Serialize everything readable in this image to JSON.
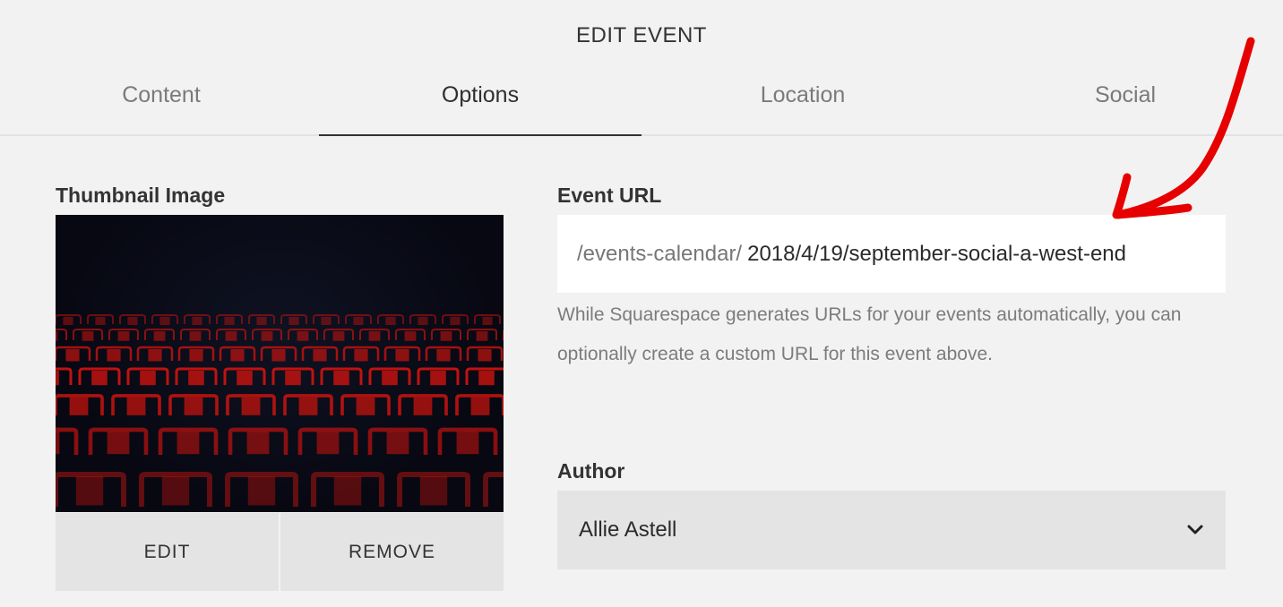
{
  "dialog": {
    "title": "EDIT EVENT"
  },
  "tabs": [
    {
      "label": "Content",
      "active": false
    },
    {
      "label": "Options",
      "active": true
    },
    {
      "label": "Location",
      "active": false
    },
    {
      "label": "Social",
      "active": false
    }
  ],
  "thumbnail": {
    "label": "Thumbnail Image",
    "edit_label": "EDIT",
    "remove_label": "REMOVE"
  },
  "event_url": {
    "label": "Event URL",
    "prefix": "/events-calendar/",
    "value": "2018/4/19/september-social-a-west-end",
    "help": "While Squarespace generates URLs for your events automatically, you can optionally create a custom URL for this event above."
  },
  "author": {
    "label": "Author",
    "selected": "Allie Astell"
  },
  "colors": {
    "background": "#f2f2f2",
    "annotation": "#e60000",
    "seats": "#c0130f"
  },
  "icons": {
    "author_dropdown": "chevron-down-icon",
    "annotation": "hand-drawn-arrow-icon"
  }
}
